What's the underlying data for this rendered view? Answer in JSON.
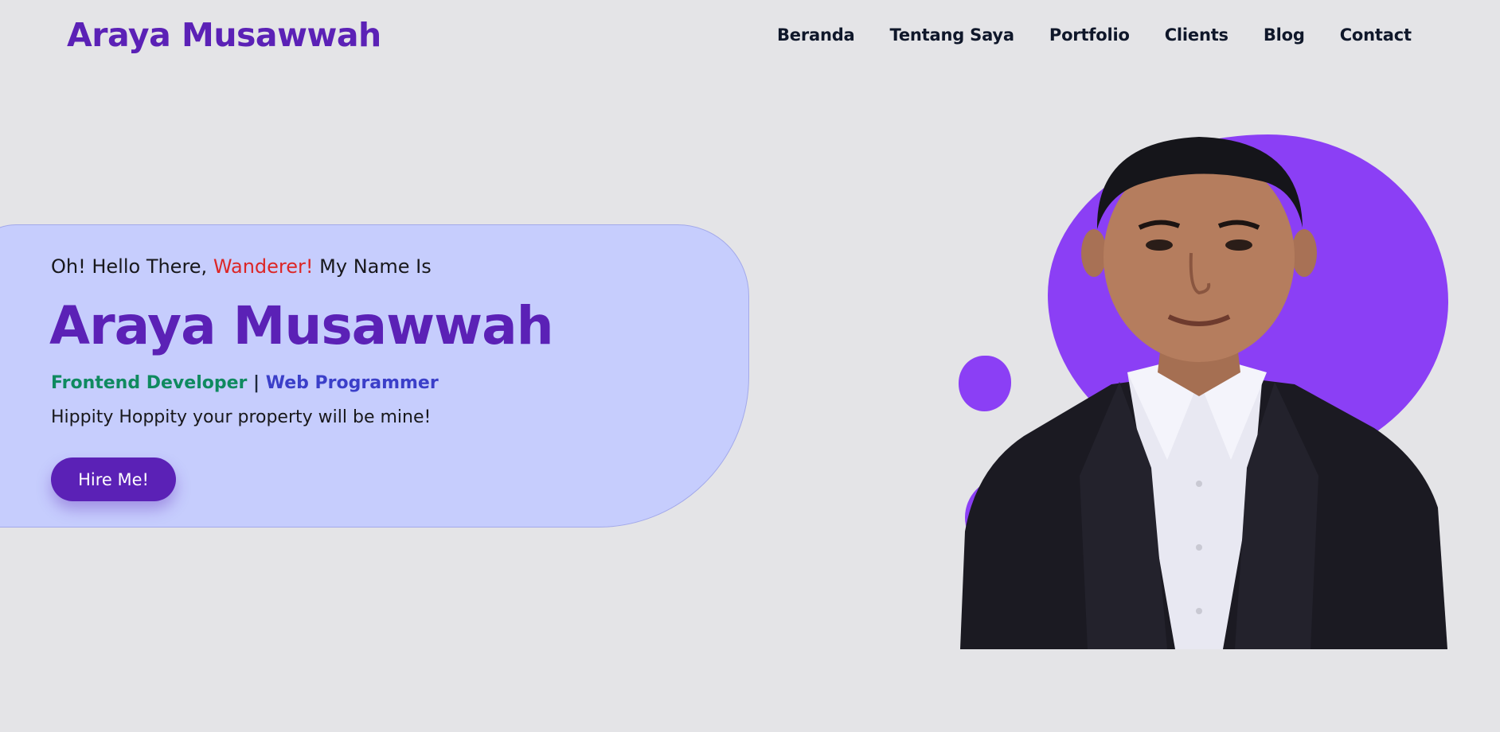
{
  "header": {
    "brand": "Araya Musawwah",
    "nav": [
      "Beranda",
      "Tentang Saya",
      "Portfolio",
      "Clients",
      "Blog",
      "Contact"
    ]
  },
  "hero": {
    "greeting_pre": "Oh! Hello There, ",
    "greeting_accent": "Wanderer!",
    "greeting_post": " My Name Is",
    "name": "Araya Musawwah",
    "role_1": "Frontend Developer",
    "role_separator": " | ",
    "role_2": "Web Programmer",
    "tagline": "Hippity Hoppity your property will be mine!",
    "cta_label": "Hire Me!"
  },
  "colors": {
    "background": "#e4e4e7",
    "brand": "#5b21b6",
    "card": "#c6cdfd",
    "accent_red": "#dc2626",
    "role_green": "#0f8a5f",
    "role_blue": "#3b3fc9",
    "blob": "#8b3ff5"
  },
  "icons": {
    "portrait": "person-portrait"
  }
}
